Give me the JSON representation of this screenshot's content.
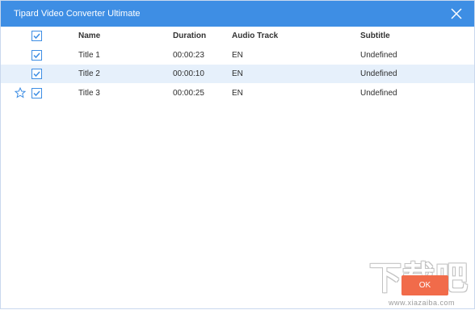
{
  "window": {
    "title": "Tipard Video Converter Ultimate"
  },
  "table": {
    "headers": {
      "name": "Name",
      "duration": "Duration",
      "audio_track": "Audio Track",
      "subtitle": "Subtitle"
    },
    "header_checked": true,
    "rows": [
      {
        "name": "Title 1",
        "duration": "00:00:23",
        "audio_track": "EN",
        "subtitle": "Undefined",
        "checked": true,
        "selected": false,
        "starred": false
      },
      {
        "name": "Title 2",
        "duration": "00:00:10",
        "audio_track": "EN",
        "subtitle": "Undefined",
        "checked": true,
        "selected": true,
        "starred": false
      },
      {
        "name": "Title 3",
        "duration": "00:00:25",
        "audio_track": "EN",
        "subtitle": "Undefined",
        "checked": true,
        "selected": false,
        "starred": true
      }
    ]
  },
  "footer": {
    "ok_label": "OK"
  },
  "watermark": {
    "text": "下载吧",
    "url": "www.xiazaiba.com"
  },
  "colors": {
    "titlebar": "#3e8ee4",
    "selected_row": "#e6f0fb",
    "ok_button": "#f16b4a",
    "checkbox": "#3e8ee4"
  },
  "icons": {
    "close": "close-icon",
    "check": "checkmark-icon",
    "favorite": "star-icon"
  }
}
